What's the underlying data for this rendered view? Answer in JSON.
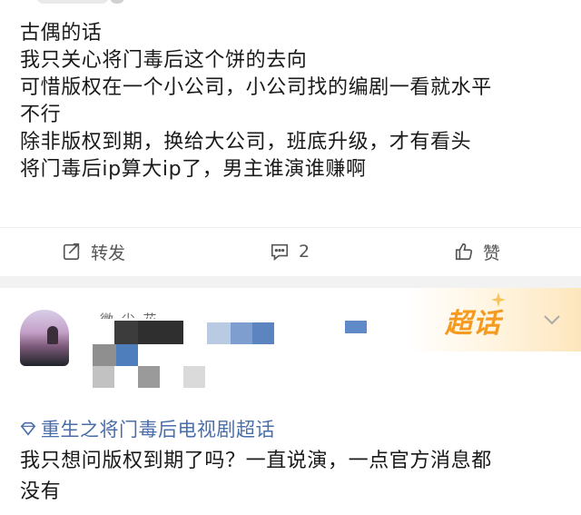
{
  "post1": {
    "lines": [
      "古偶的话",
      "我只关心将门毒后这个饼的去向",
      "可惜版权在一个小公司，小公司找的编剧一看就水平",
      "不行",
      "除非版权到期，换给大公司，班底升级，才有看头",
      "将门毒后ip算大ip了，男主谁演谁赚啊"
    ],
    "actions": {
      "repost_label": "转发",
      "comment_count": "2",
      "like_label": "赞"
    }
  },
  "post2": {
    "badge": "超话",
    "nickname_fragment": "微  尘  花",
    "topic": "重生之将门毒后电视剧超话",
    "lines": [
      "我只想问版权到期了吗？一直说演，一点官方消息都",
      "没有"
    ]
  },
  "colors": {
    "accent_orange": "#f59a1f",
    "topic_blue": "#4a6ea9",
    "divider_gray": "#f2f2f2"
  }
}
